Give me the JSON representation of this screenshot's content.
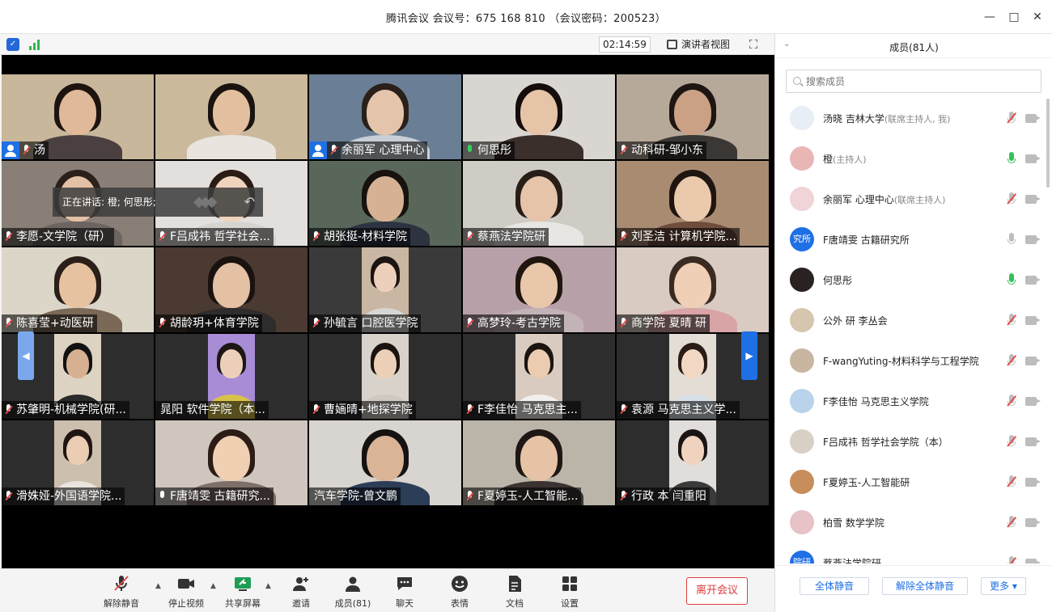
{
  "window": {
    "title": "腾讯会议 会议号：675 168 810 （会议密码：200523）",
    "controls": [
      "minimize-icon",
      "maximize-icon",
      "close-icon"
    ]
  },
  "meeting_topbar": {
    "timer": "02:14:59",
    "speaker_view_label": "演讲者视图"
  },
  "speaking_banner": {
    "text": "正在讲话: 橙; 何思彤;"
  },
  "tiles": [
    {
      "name": "汤",
      "host": true,
      "mic": "muted",
      "bg": "#c9b79b",
      "hair": "#1d1410",
      "face": "#e0b99a",
      "body": "#4b4040"
    },
    {
      "name": "",
      "host": false,
      "mic": "none",
      "bg": "#cbb99c",
      "hair": "#1a1410",
      "face": "#e2bf9f",
      "body": "#e9e4de",
      "active": true
    },
    {
      "name": "余丽军 心理中心",
      "host": true,
      "mic": "muted",
      "bg": "#6a7f95",
      "hair": "#2a1f19",
      "face": "#e4c5ab",
      "body": "#c9cfd6"
    },
    {
      "name": "何思彤",
      "host": false,
      "mic": "on",
      "bg": "#d9d6d2",
      "hair": "#140d0b",
      "face": "#e6c4a8",
      "body": "#3b2f2b"
    },
    {
      "name": "动科研-邹小东",
      "host": false,
      "mic": "muted",
      "bg": "#b7a99a",
      "hair": "#1d1612",
      "face": "#caa184",
      "body": "#3b3734"
    },
    {
      "name": "李愿-文学院（研）",
      "host": false,
      "mic": "muted",
      "bg": "#8a7f76",
      "hair": "#2b201a",
      "face": "#e3c1a6",
      "body": "#6c6461"
    },
    {
      "name": "F吕成祎 哲学社会...",
      "host": false,
      "mic": "muted",
      "bg": "#e2dfdc",
      "hair": "#2a1c15",
      "face": "#f0d3bd",
      "body": "#d7d3cf"
    },
    {
      "name": "胡张挺-材料学院",
      "host": false,
      "mic": "muted",
      "bg": "#59675a",
      "hair": "#17120f",
      "face": "#d6b194",
      "body": "#2d3341"
    },
    {
      "name": "蔡燕法学院研",
      "host": false,
      "mic": "muted",
      "bg": "#cfccc6",
      "hair": "#281d17",
      "face": "#e5c4a9",
      "body": "#e8e6e3"
    },
    {
      "name": "刘圣洁 计算机学院...",
      "host": false,
      "mic": "muted",
      "bg": "#a98b72",
      "hair": "#1f1510",
      "face": "#ebc9ad",
      "body": "#6e4d3c"
    },
    {
      "name": "陈喜莹+动医研",
      "host": false,
      "mic": "muted",
      "bg": "#dcd6c8",
      "hair": "#2b1f19",
      "face": "#e7c2a1",
      "body": "#7a6956"
    },
    {
      "name": "胡龄玥+体育学院",
      "host": false,
      "mic": "muted",
      "bg": "#4a3a32",
      "hair": "#1a120e",
      "face": "#e4c0a4",
      "body": "#2f2c2c"
    },
    {
      "name": "孙毓言 口腔医学院",
      "host": false,
      "mic": "muted",
      "bg": "#3a3a3a",
      "hair": "#1b1411",
      "face": "#ecd0bb",
      "body": "#d8d6d4",
      "phone": "#c9b6a3"
    },
    {
      "name": "高梦玲-考古学院",
      "host": false,
      "mic": "muted",
      "bg": "#b8a0a8",
      "hair": "#20160f",
      "face": "#e8c7aa",
      "body": "#c2b3b7"
    },
    {
      "name": "商学院 夏晴 研",
      "host": false,
      "mic": "muted",
      "bg": "#d9cbc1",
      "hair": "#3a2b22",
      "face": "#efcfb5",
      "body": "#d8a4a6"
    },
    {
      "name": "苏肇明-机械学院(研...",
      "host": false,
      "mic": "muted",
      "bg": "#2d2d2d",
      "hair": "#121212",
      "face": "#d7b092",
      "body": "#2a2a2a",
      "phone": "#ddd3c3"
    },
    {
      "name": "晁阳 软件学院（本...",
      "host": false,
      "mic": "none",
      "bg": "#2d2d2d",
      "hair": "#1c1614",
      "face": "#ecd0ba",
      "body": "#d8c24a",
      "phone": "#a88cd6"
    },
    {
      "name": "曹婳晴+地探学院",
      "host": false,
      "mic": "muted",
      "bg": "#2d2d2d",
      "hair": "#1a1310",
      "face": "#ecd0b8",
      "body": "#cfc8c0",
      "phone": "#d8d2cb"
    },
    {
      "name": "F李佳怡 马克思主...",
      "host": false,
      "mic": "muted",
      "bg": "#2d2d2d",
      "hair": "#1b1411",
      "face": "#ebccb1",
      "body": "#f2f0ee",
      "phone": "#d9cbbf"
    },
    {
      "name": "袁源 马克思主义学...",
      "host": false,
      "mic": "muted",
      "bg": "#2d2d2d",
      "hair": "#2a1c15",
      "face": "#f2d8c4",
      "body": "#d7e0e8",
      "phone": "#e3ddd5"
    },
    {
      "name": "滑姝娅-外国语学院...",
      "host": false,
      "mic": "muted",
      "bg": "#2d2d2d",
      "hair": "#1f1612",
      "face": "#ebcdb3",
      "body": "#e9e4de",
      "phone": "#cdbfae"
    },
    {
      "name": "F唐靖雯 古籍研究...",
      "host": false,
      "mic": "plain",
      "bg": "#cfc6bd",
      "hair": "#2b1d16",
      "face": "#f0cfb3",
      "body": "#7f6f69"
    },
    {
      "name": "汽车学院-曾文鹏",
      "host": false,
      "mic": "none",
      "bg": "#d8d4cf",
      "hair": "#161212",
      "face": "#d9b496",
      "body": "#2c3d57"
    },
    {
      "name": "F夏婷玉-人工智能...",
      "host": false,
      "mic": "muted",
      "bg": "#bbb4a8",
      "hair": "#1f1713",
      "face": "#e6c3a6",
      "body": "#3a3332"
    },
    {
      "name": "行政 本 闫重阳",
      "host": false,
      "mic": "muted",
      "bg": "#2d2d2d",
      "hair": "#1a1413",
      "face": "#efd3be",
      "body": "#3a3a3a",
      "phone": "#e0ddda"
    }
  ],
  "toolbar": [
    {
      "label": "解除静音",
      "icon": "mic-muted-icon",
      "caret": true
    },
    {
      "label": "停止视频",
      "icon": "video-camera-icon",
      "caret": true
    },
    {
      "label": "共享屏幕",
      "icon": "share-screen-icon",
      "caret": true
    },
    {
      "label": "邀请",
      "icon": "add-user-icon",
      "caret": false
    },
    {
      "label": "成员(81)",
      "icon": "members-icon",
      "caret": false
    },
    {
      "label": "聊天",
      "icon": "chat-icon",
      "caret": false
    },
    {
      "label": "表情",
      "icon": "emoji-icon",
      "caret": false
    },
    {
      "label": "文档",
      "icon": "document-icon",
      "caret": false
    },
    {
      "label": "设置",
      "icon": "settings-icon",
      "caret": false
    }
  ],
  "leave_button": "离开会议",
  "panel": {
    "title": "成员(81人)",
    "search_placeholder": "搜索成员",
    "members": [
      {
        "name": "汤晓 吉林大学",
        "role": "(联席主持人, 我)",
        "mic": "muted",
        "avatar_color": "#e8eef6",
        "avatar_text": ""
      },
      {
        "name": "橙",
        "role": "(主持人)",
        "mic": "on",
        "avatar_color": "#e9b6b6",
        "avatar_text": ""
      },
      {
        "name": "余丽军 心理中心",
        "role": "(联席主持人)",
        "mic": "muted",
        "avatar_color": "#f1d4d8",
        "avatar_text": ""
      },
      {
        "name": "F唐靖雯 古籍研究所",
        "role": "",
        "mic": "plain",
        "avatar_color": "#1f6fe5",
        "avatar_text": "究所"
      },
      {
        "name": "何思彤",
        "role": "",
        "mic": "on",
        "avatar_color": "#2a2220",
        "avatar_text": ""
      },
      {
        "name": "公外 研 李丛会",
        "role": "",
        "mic": "muted",
        "avatar_color": "#d6c6ae",
        "avatar_text": ""
      },
      {
        "name": "F-wangYuting-材料科学与工程学院",
        "role": "",
        "mic": "muted",
        "avatar_color": "#c9b6a1",
        "avatar_text": ""
      },
      {
        "name": "F李佳怡 马克思主义学院",
        "role": "",
        "mic": "muted",
        "avatar_color": "#b9d4ea",
        "avatar_text": ""
      },
      {
        "name": "F吕成祎 哲学社会学院（本）",
        "role": "",
        "mic": "muted",
        "avatar_color": "#d8d0c4",
        "avatar_text": ""
      },
      {
        "name": "F夏婷玉-人工智能研",
        "role": "",
        "mic": "muted",
        "avatar_color": "#c78d5b",
        "avatar_text": ""
      },
      {
        "name": "柏雪 数学学院",
        "role": "",
        "mic": "muted",
        "avatar_color": "#e7c2c6",
        "avatar_text": ""
      },
      {
        "name": "蔡燕法学院研",
        "role": "",
        "mic": "muted",
        "avatar_color": "#1f6fe5",
        "avatar_text": "院研"
      }
    ],
    "footer": {
      "mute_all": "全体静音",
      "unmute_all": "解除全体静音",
      "more": "更多 ▾"
    }
  }
}
